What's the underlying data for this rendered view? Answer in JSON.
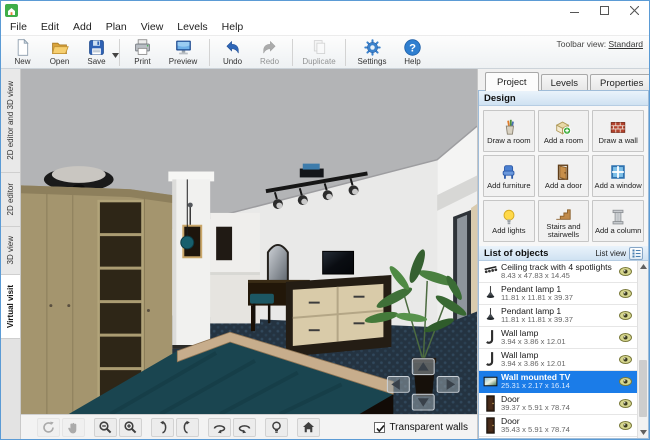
{
  "menu": {
    "items": [
      "File",
      "Edit",
      "Add",
      "Plan",
      "View",
      "Levels",
      "Help"
    ]
  },
  "toolbar": {
    "view_label": "Toolbar view:",
    "view_value": "Standard",
    "buttons": [
      {
        "label": "New",
        "enabled": true
      },
      {
        "label": "Open",
        "enabled": true
      },
      {
        "label": "Save",
        "enabled": true
      },
      {
        "label": "Print",
        "enabled": true
      },
      {
        "label": "Preview",
        "enabled": true
      },
      {
        "label": "Undo",
        "enabled": true
      },
      {
        "label": "Redo",
        "enabled": false
      },
      {
        "label": "Duplicate",
        "enabled": false
      },
      {
        "label": "Settings",
        "enabled": true
      },
      {
        "label": "Help",
        "enabled": true
      }
    ]
  },
  "left_tabs": {
    "items": [
      {
        "label": "2D editor and 3D view",
        "active": false
      },
      {
        "label": "2D editor",
        "active": false
      },
      {
        "label": "3D view",
        "active": false
      },
      {
        "label": "Virtual visit",
        "active": true
      }
    ]
  },
  "right_panel": {
    "tabs": [
      {
        "label": "Project",
        "active": true
      },
      {
        "label": "Levels",
        "active": false
      },
      {
        "label": "Properties",
        "active": false
      }
    ],
    "design": {
      "title": "Design",
      "buttons": [
        "Draw a room",
        "Add a room",
        "Draw a wall",
        "Add furniture",
        "Add a door",
        "Add a window",
        "Add lights",
        "Stairs and stairwells",
        "Add a column"
      ]
    },
    "objects": {
      "title": "List of objects",
      "view_label": "List view",
      "items": [
        {
          "name": "Ceiling track with 4 spotlights",
          "dims": "8.43 x 47.83 x 14.45",
          "selected": false
        },
        {
          "name": "Pendant lamp 1",
          "dims": "11.81 x 11.81 x 39.37",
          "selected": false
        },
        {
          "name": "Pendant lamp 1",
          "dims": "11.81 x 11.81 x 39.37",
          "selected": false
        },
        {
          "name": "Wall lamp",
          "dims": "3.94 x 3.86 x 12.01",
          "selected": false
        },
        {
          "name": "Wall lamp",
          "dims": "3.94 x 3.86 x 12.01",
          "selected": false
        },
        {
          "name": "Wall mounted TV",
          "dims": "25.31 x 2.17 x 16.14",
          "selected": true
        },
        {
          "name": "Door",
          "dims": "39.37 x 5.91 x 78.74",
          "selected": false
        },
        {
          "name": "Door",
          "dims": "35.43 x 5.91 x 78.74",
          "selected": false
        }
      ]
    }
  },
  "status_bar": {
    "buttons": [
      {
        "icon": "rotate-360-icon",
        "enabled": false
      },
      {
        "icon": "pan-hand-icon",
        "enabled": false
      },
      {
        "icon": "zoom-out-icon",
        "enabled": true
      },
      {
        "icon": "zoom-in-icon",
        "enabled": true
      },
      {
        "icon": "tilt-left-icon",
        "enabled": true
      },
      {
        "icon": "tilt-right-icon",
        "enabled": true
      },
      {
        "icon": "orbit-left-icon",
        "enabled": true
      },
      {
        "icon": "orbit-right-icon",
        "enabled": true
      },
      {
        "icon": "light-icon",
        "enabled": true
      },
      {
        "icon": "home-view-icon",
        "enabled": true
      }
    ],
    "transparent_walls": {
      "label": "Transparent walls",
      "checked": true
    }
  },
  "colors": {
    "selection_blue": "#1b7ce8",
    "header_blue_top": "#eaf3fb",
    "header_blue_bottom": "#cfe2f2",
    "carpet": "#243341",
    "bed_cover": "#1a4550",
    "wall": "#e9e9e8",
    "wardrobe_wood": "#a4956e",
    "accent": "#2f7fd0"
  }
}
